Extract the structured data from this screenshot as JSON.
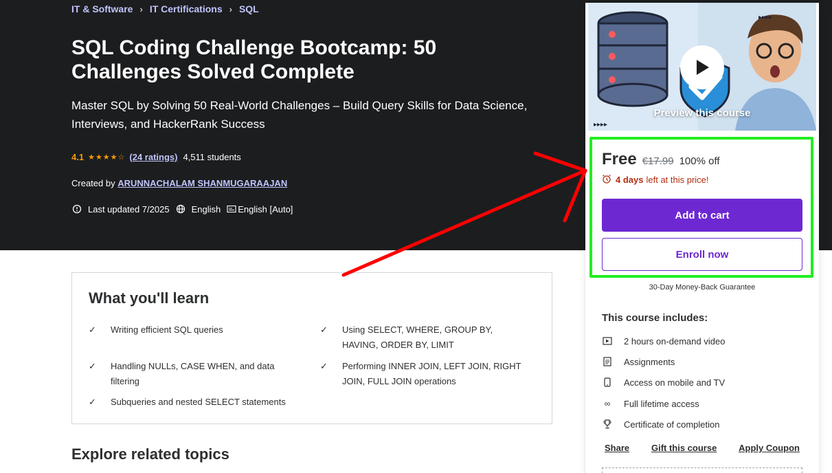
{
  "breadcrumb": [
    {
      "label": "IT & Software"
    },
    {
      "label": "IT Certifications"
    },
    {
      "label": "SQL"
    }
  ],
  "course": {
    "title": "SQL Coding Challenge Bootcamp: 50 Challenges Solved Complete",
    "subtitle": "Master SQL by Solving 50 Real-World Challenges – Build Query Skills for Data Science, Interviews, and HackerRank Success",
    "rating": "4.1",
    "stars": "★★★★☆",
    "ratings_count": "(24 ratings)",
    "students": "4,511 students",
    "created_by_label": "Created by",
    "instructor": "ARUNNACHALAM SHANMUGARAAJAN",
    "last_updated": "Last updated 7/2025",
    "language": "English",
    "captions": "English [Auto]"
  },
  "learn": {
    "heading": "What you'll learn",
    "items": [
      "Writing efficient SQL queries",
      "Using SELECT, WHERE, GROUP BY, HAVING, ORDER BY, LIMIT",
      "Handling NULLs, CASE WHEN, and data filtering",
      "Performing INNER JOIN, LEFT JOIN, RIGHT JOIN, FULL JOIN operations",
      "Subqueries and nested SELECT statements"
    ]
  },
  "explore_heading": "Explore related topics",
  "sidebar": {
    "preview_label": "Preview this course",
    "price": "Free",
    "original_price": "€17.99",
    "discount": "100% off",
    "timer_bold": "4 days",
    "timer_rest": "left at this price!",
    "add_to_cart": "Add to cart",
    "enroll_now": "Enroll now",
    "guarantee": "30-Day Money-Back Guarantee",
    "includes_title": "This course includes:",
    "includes": [
      {
        "icon": "video-icon",
        "label": "2 hours on-demand video"
      },
      {
        "icon": "assignment-icon",
        "label": "Assignments"
      },
      {
        "icon": "mobile-icon",
        "label": "Access on mobile and TV"
      },
      {
        "icon": "infinity-icon",
        "label": "Full lifetime access"
      },
      {
        "icon": "trophy-icon",
        "label": "Certificate of completion"
      }
    ],
    "share": "Share",
    "gift": "Gift this course",
    "coupon": "Apply Coupon"
  },
  "colors": {
    "hero_bg": "#1c1d1f",
    "accent_purple": "#6d28d2",
    "link_lavender": "#c0c4fc",
    "star_orange": "#f69c08",
    "timer_red": "#b32d0f",
    "highlight_green": "#22ee22",
    "annotation_red": "#ff0000"
  }
}
